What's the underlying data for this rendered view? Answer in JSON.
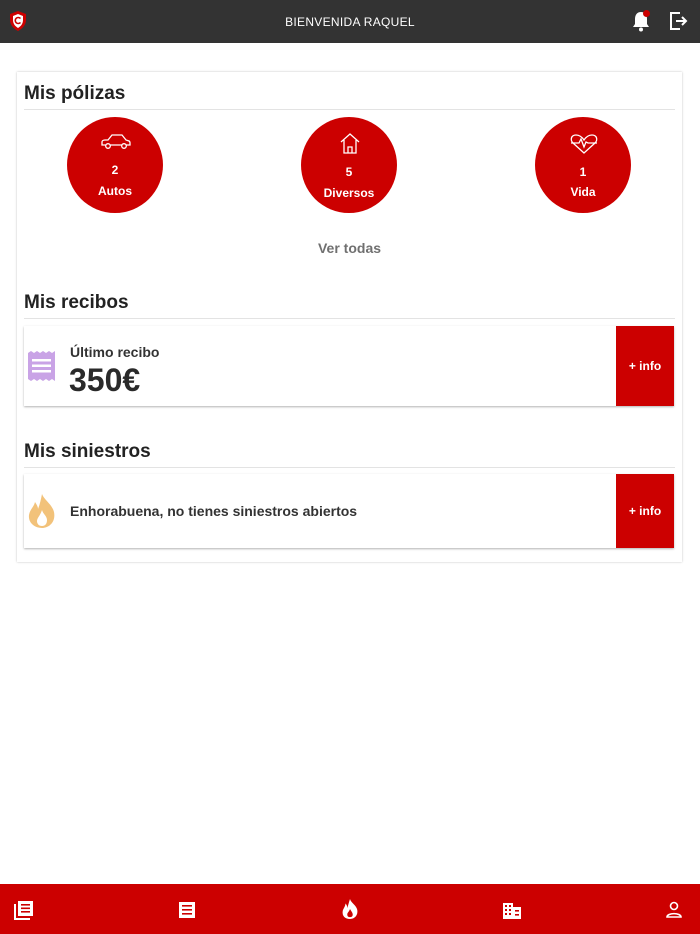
{
  "header": {
    "title": "BIENVENIDA RAQUEL",
    "logo_icon": "shield-logo-icon",
    "bell_icon": "bell-icon",
    "logout_icon": "logout-icon",
    "notification_dot_color": "#cc0000"
  },
  "policies": {
    "title": "Mis pólizas",
    "items": [
      {
        "icon": "car-icon",
        "count": "2",
        "label": "Autos"
      },
      {
        "icon": "house-icon",
        "count": "5",
        "label": "Diversos"
      },
      {
        "icon": "heartbeat-icon",
        "count": "1",
        "label": "Vida"
      }
    ],
    "view_all": "Ver todas"
  },
  "receipts": {
    "title": "Mis recibos",
    "last_label": "Último recibo",
    "amount": "350€",
    "icon": "receipt-icon",
    "button": "+ info"
  },
  "claims": {
    "title": "Mis siniestros",
    "message": "Enhorabuena, no tienes siniestros abiertos",
    "icon": "fire-icon",
    "button": "+ info"
  },
  "bottom_nav": [
    "news-icon",
    "receipt-nav-icon",
    "fire-nav-icon",
    "building-icon",
    "user-icon"
  ],
  "colors": {
    "accent": "#cc0000",
    "topbar": "#333333",
    "receipt_icon": "#c9a3e6",
    "fire_icon": "#f2c27a"
  }
}
